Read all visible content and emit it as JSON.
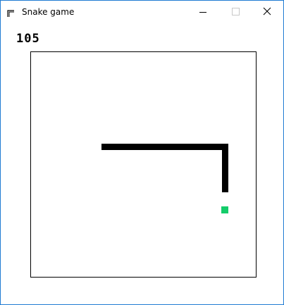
{
  "window": {
    "title": "Snake game",
    "border_color": "#1f7bd3"
  },
  "icons": {
    "app": "app-corner-icon",
    "minimize": "minimize-icon",
    "maximize": "maximize-icon",
    "close": "close-icon"
  },
  "game": {
    "score": "105",
    "snake_color": "#000000",
    "food_color": "#14cc6a"
  }
}
